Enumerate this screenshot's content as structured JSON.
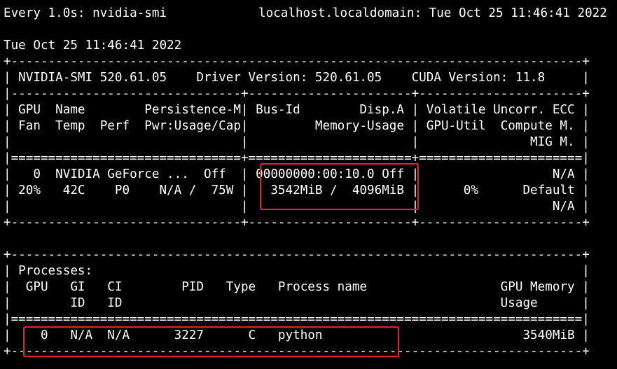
{
  "header": {
    "watch_cmd": "Every 1.0s: nvidia-smi",
    "host_time": "localhost.localdomain: Tue Oct 25 11:46:41 2022"
  },
  "timestamp": "Tue Oct 25 11:46:41 2022",
  "lines": [
    "+-----------------------------------------------------------------------------+",
    "| NVIDIA-SMI 520.61.05    Driver Version: 520.61.05    CUDA Version: 11.8     |",
    "|-------------------------------+----------------------+----------------------+",
    "| GPU  Name        Persistence-M| Bus-Id        Disp.A | Volatile Uncorr. ECC |",
    "| Fan  Temp  Perf  Pwr:Usage/Cap|         Memory-Usage | GPU-Util  Compute M. |",
    "|                               |                      |               MIG M. |",
    "|===============================+======================+======================|",
    "|   0  NVIDIA GeForce ...  Off  | 00000000:00:10.0 Off |                  N/A |",
    "| 20%   42C    P0    N/A /  75W |   3542MiB /  4096MiB |      0%      Default |",
    "|                               |                      |                  N/A |",
    "+-------------------------------+----------------------+----------------------+",
    "",
    "+-----------------------------------------------------------------------------+",
    "| Processes:                                                                  |",
    "|  GPU   GI   CI        PID   Type   Process name                  GPU Memory |",
    "|        ID   ID                                                   Usage      |",
    "|=============================================================================|",
    "|    0   N/A  N/A      3227      C   python                           3540MiB |",
    "+-----------------------------------------------------------------------------+"
  ]
}
